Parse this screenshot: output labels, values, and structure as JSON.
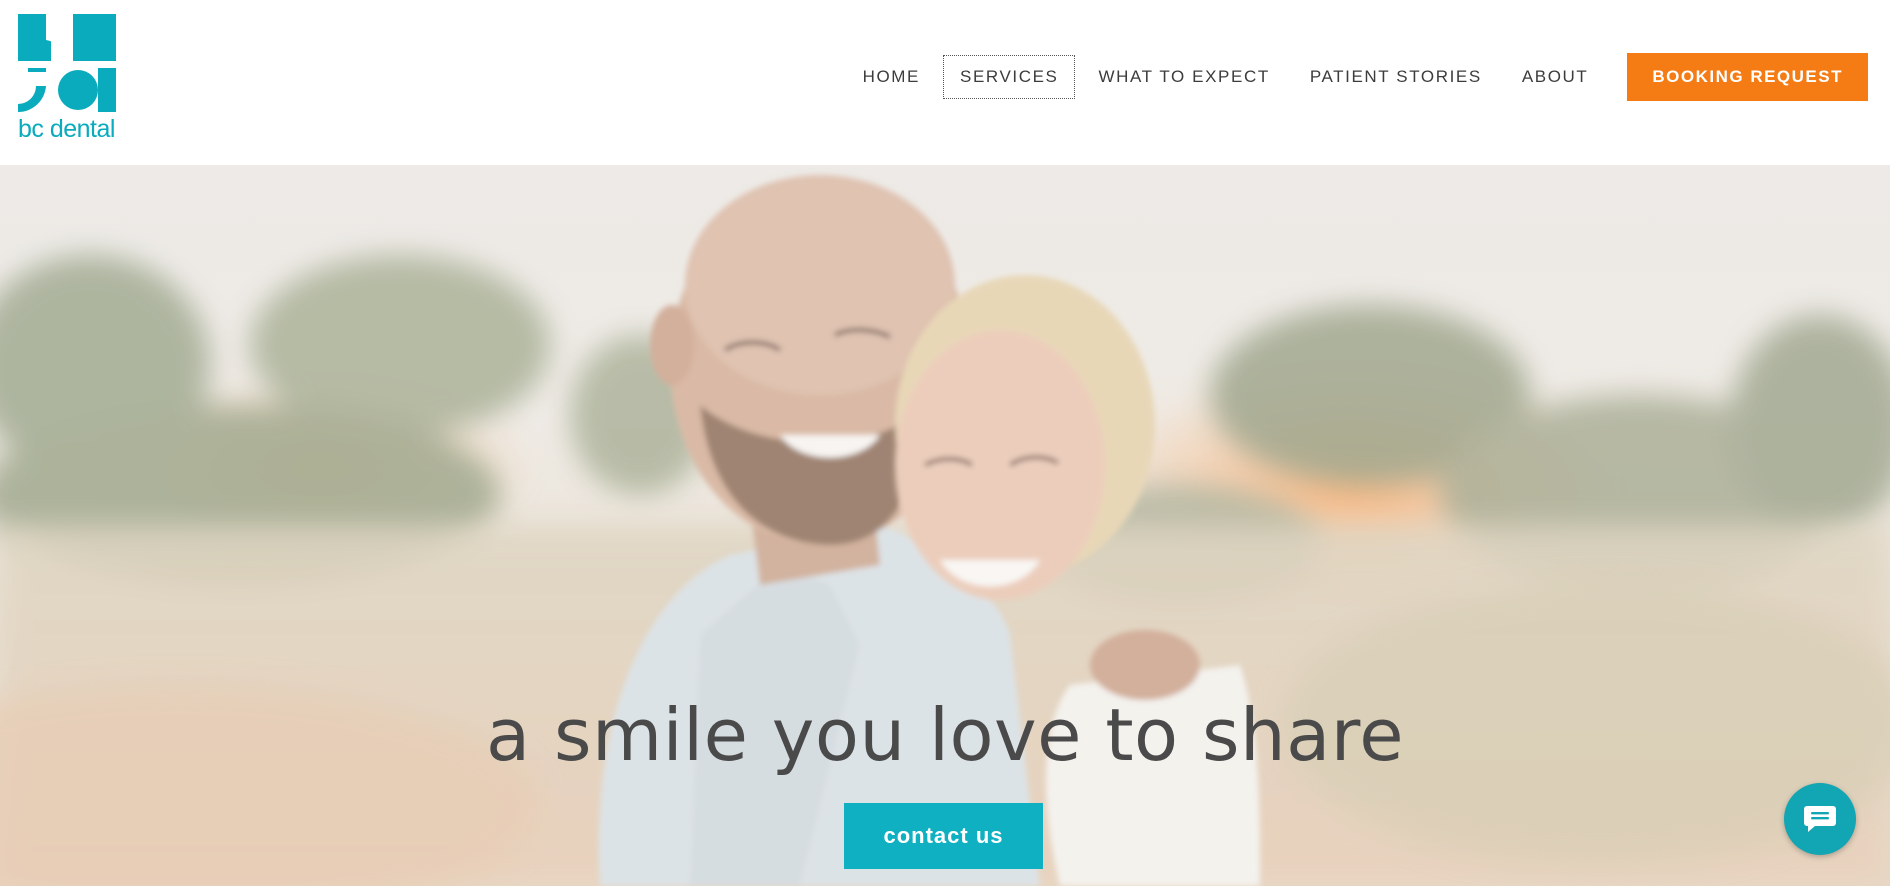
{
  "brand": {
    "name": "bc dental",
    "logo_icon": "bc-dental-monogram",
    "color": "#0aabbd"
  },
  "nav": {
    "items": [
      {
        "label": "HOME"
      },
      {
        "label": "SERVICES"
      },
      {
        "label": "WHAT TO EXPECT"
      },
      {
        "label": "PATIENT STORIES"
      },
      {
        "label": "ABOUT"
      }
    ],
    "booking_label": "BOOKING REQUEST",
    "booking_color": "#f57c15"
  },
  "hero": {
    "headline": "a smile you love to share",
    "cta_label": "contact us",
    "cta_color": "#0fb0c1",
    "image": "smiling-couple-outdoors-photo"
  },
  "chat": {
    "icon": "chat-bubble-icon",
    "color": "#12a5b3"
  }
}
